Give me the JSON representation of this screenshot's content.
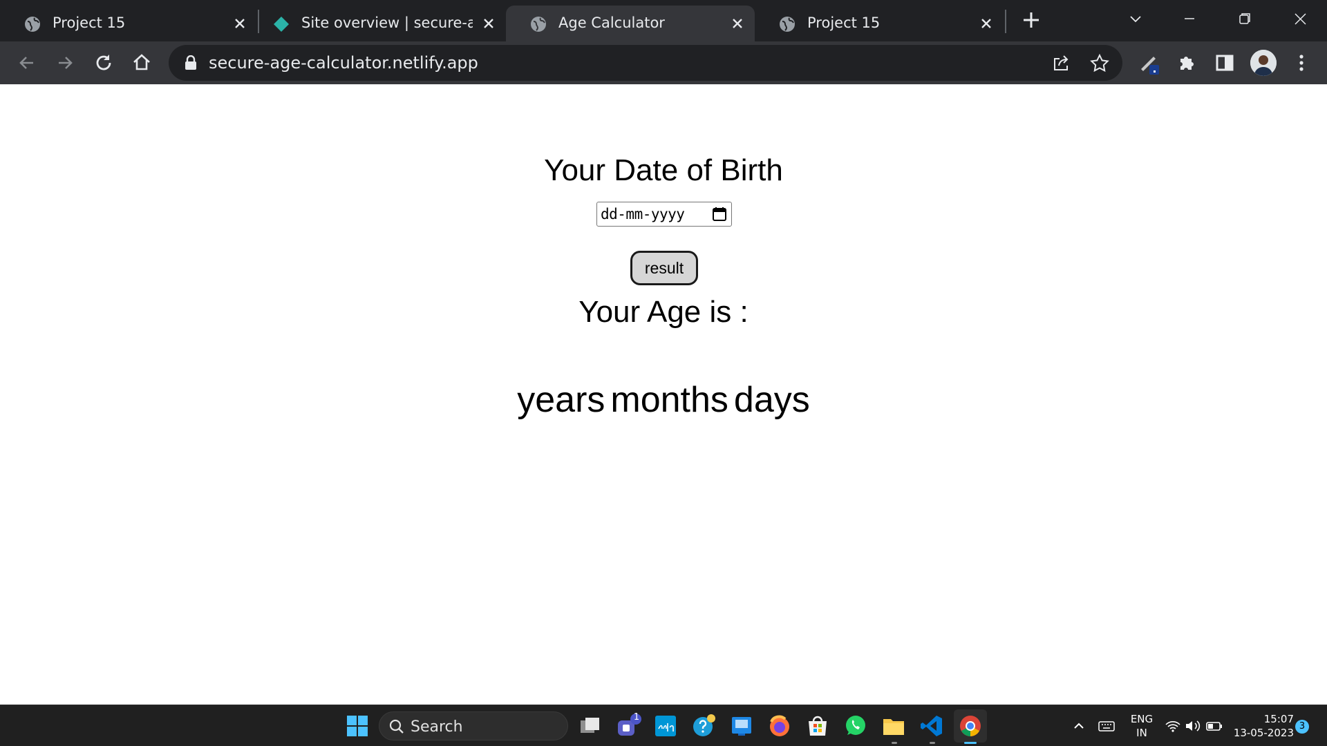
{
  "browser": {
    "tabs": [
      {
        "title": "Project 15",
        "favicon": "globe-icon",
        "active": false
      },
      {
        "title": "Site overview | secure-age-",
        "favicon": "netlify-icon",
        "active": false
      },
      {
        "title": "Age Calculator",
        "favicon": "globe-icon",
        "active": true
      },
      {
        "title": "Project 15",
        "favicon": "globe-icon",
        "active": false
      }
    ],
    "url": "secure-age-calculator.netlify.app"
  },
  "page": {
    "dob_heading": "Your Date of Birth",
    "date_placeholder": "dd-mm-yyyy",
    "result_button": "result",
    "age_heading": "Your Age is :",
    "age_result": {
      "years_label": "years",
      "months_label": "months",
      "days_label": "days"
    }
  },
  "taskbar": {
    "search_label": "Search",
    "teams_badge": "1",
    "language": {
      "line1": "ENG",
      "line2": "IN"
    },
    "time": "15:07",
    "date": "13-05-2023",
    "notification_count": "3"
  },
  "colors": {
    "tabstrip": "#202124",
    "toolbar": "#35363a",
    "taskbar": "#202020",
    "accent": "#4cc2ff"
  }
}
